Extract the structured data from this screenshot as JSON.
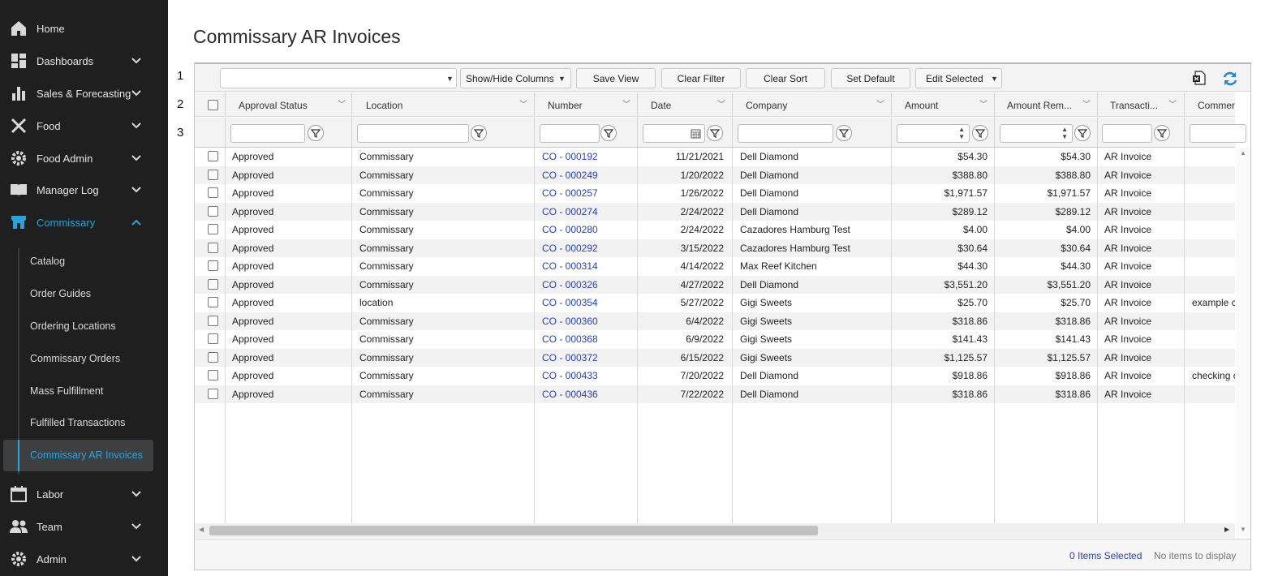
{
  "sidebar": {
    "items": [
      {
        "label": "Home",
        "icon": "home-icon"
      },
      {
        "label": "Dashboards",
        "icon": "dashboard-icon"
      },
      {
        "label": "Sales & Forecasting",
        "icon": "bar-chart-icon"
      },
      {
        "label": "Food",
        "icon": "utensils-icon"
      },
      {
        "label": "Food Admin",
        "icon": "gear-icon"
      },
      {
        "label": "Manager Log",
        "icon": "book-icon"
      },
      {
        "label": "Commissary",
        "icon": "store-icon"
      },
      {
        "label": "Labor",
        "icon": "calendar-icon"
      },
      {
        "label": "Team",
        "icon": "people-icon"
      },
      {
        "label": "Admin",
        "icon": "gear-icon"
      }
    ],
    "commissary_sub": [
      "Catalog",
      "Order Guides",
      "Ordering Locations",
      "Commissary Orders",
      "Mass Fulfillment",
      "Fulfilled Transactions",
      "Commissary AR Invoices"
    ],
    "accent_color": "#29a3dc"
  },
  "page": {
    "title": "Commissary AR Invoices",
    "row_markers": [
      "1",
      "2",
      "3"
    ]
  },
  "toolbar": {
    "view_select": "",
    "show_hide": "Show/Hide Columns",
    "save_view": "Save View",
    "clear_filter": "Clear Filter",
    "clear_sort": "Clear Sort",
    "set_default": "Set Default",
    "edit_selected": "Edit Selected"
  },
  "columns": [
    "Approval Status",
    "Location",
    "Number",
    "Date",
    "Company",
    "Amount",
    "Amount Rem...",
    "Transacti...",
    "Commer"
  ],
  "rows": [
    {
      "status": "Approved",
      "location": "Commissary",
      "number": "CO - 000192",
      "date": "11/21/2021",
      "company": "Dell Diamond",
      "amount": "$54.30",
      "remaining": "$54.30",
      "type": "AR Invoice",
      "comment": ""
    },
    {
      "status": "Approved",
      "location": "Commissary",
      "number": "CO - 000249",
      "date": "1/20/2022",
      "company": "Dell Diamond",
      "amount": "$388.80",
      "remaining": "$388.80",
      "type": "AR Invoice",
      "comment": ""
    },
    {
      "status": "Approved",
      "location": "Commissary",
      "number": "CO - 000257",
      "date": "1/26/2022",
      "company": "Dell Diamond",
      "amount": "$1,971.57",
      "remaining": "$1,971.57",
      "type": "AR Invoice",
      "comment": ""
    },
    {
      "status": "Approved",
      "location": "Commissary",
      "number": "CO - 000274",
      "date": "2/24/2022",
      "company": "Dell Diamond",
      "amount": "$289.12",
      "remaining": "$289.12",
      "type": "AR Invoice",
      "comment": ""
    },
    {
      "status": "Approved",
      "location": "Commissary",
      "number": "CO - 000280",
      "date": "2/24/2022",
      "company": "Cazadores Hamburg Test",
      "amount": "$4.00",
      "remaining": "$4.00",
      "type": "AR Invoice",
      "comment": ""
    },
    {
      "status": "Approved",
      "location": "Commissary",
      "number": "CO - 000292",
      "date": "3/15/2022",
      "company": "Cazadores Hamburg Test",
      "amount": "$30.64",
      "remaining": "$30.64",
      "type": "AR Invoice",
      "comment": ""
    },
    {
      "status": "Approved",
      "location": "Commissary",
      "number": "CO - 000314",
      "date": "4/14/2022",
      "company": "Max Reef Kitchen",
      "amount": "$44.30",
      "remaining": "$44.30",
      "type": "AR Invoice",
      "comment": ""
    },
    {
      "status": "Approved",
      "location": "Commissary",
      "number": "CO - 000326",
      "date": "4/27/2022",
      "company": "Dell Diamond",
      "amount": "$3,551.20",
      "remaining": "$3,551.20",
      "type": "AR Invoice",
      "comment": ""
    },
    {
      "status": "Approved",
      "location": "location",
      "number": "CO - 000354",
      "date": "5/27/2022",
      "company": "Gigi Sweets",
      "amount": "$25.70",
      "remaining": "$25.70",
      "type": "AR Invoice",
      "comment": "example c"
    },
    {
      "status": "Approved",
      "location": "Commissary",
      "number": "CO - 000360",
      "date": "6/4/2022",
      "company": "Gigi Sweets",
      "amount": "$318.86",
      "remaining": "$318.86",
      "type": "AR Invoice",
      "comment": ""
    },
    {
      "status": "Approved",
      "location": "Commissary",
      "number": "CO - 000368",
      "date": "6/9/2022",
      "company": "Gigi Sweets",
      "amount": "$141.43",
      "remaining": "$141.43",
      "type": "AR Invoice",
      "comment": ""
    },
    {
      "status": "Approved",
      "location": "Commissary",
      "number": "CO - 000372",
      "date": "6/15/2022",
      "company": "Gigi Sweets",
      "amount": "$1,125.57",
      "remaining": "$1,125.57",
      "type": "AR Invoice",
      "comment": ""
    },
    {
      "status": "Approved",
      "location": "Commissary",
      "number": "CO - 000433",
      "date": "7/20/2022",
      "company": "Dell Diamond",
      "amount": "$918.86",
      "remaining": "$918.86",
      "type": "AR Invoice",
      "comment": "checking c"
    },
    {
      "status": "Approved",
      "location": "Commissary",
      "number": "CO - 000436",
      "date": "7/22/2022",
      "company": "Dell Diamond",
      "amount": "$318.86",
      "remaining": "$318.86",
      "type": "AR Invoice",
      "comment": ""
    }
  ],
  "footer": {
    "selected": "0 Items Selected",
    "empty": "No items to display"
  },
  "link_color": "#2540c9"
}
